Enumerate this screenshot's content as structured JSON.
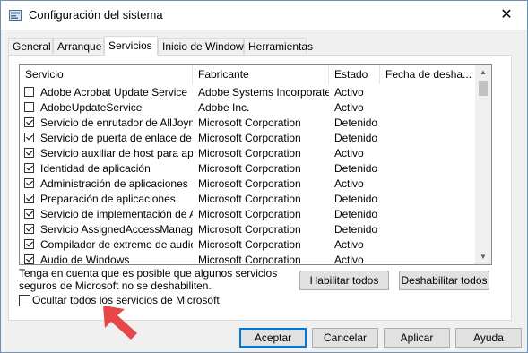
{
  "window": {
    "title": "Configuración del sistema",
    "close_glyph": "✕"
  },
  "tabs": [
    {
      "label": "General",
      "active": false
    },
    {
      "label": "Arranque",
      "active": false
    },
    {
      "label": "Servicios",
      "active": true
    },
    {
      "label": "Inicio de Windows",
      "active": false
    },
    {
      "label": "Herramientas",
      "active": false
    }
  ],
  "services_list": {
    "columns": [
      "Servicio",
      "Fabricante",
      "Estado",
      "Fecha de desha..."
    ],
    "rows": [
      {
        "checked": false,
        "service": "Adobe Acrobat Update Service",
        "manufacturer": "Adobe Systems Incorporated",
        "status": "Activo"
      },
      {
        "checked": false,
        "service": "AdobeUpdateService",
        "manufacturer": "Adobe Inc.",
        "status": "Activo"
      },
      {
        "checked": true,
        "service": "Servicio de enrutador de AllJoyn",
        "manufacturer": "Microsoft Corporation",
        "status": "Detenido"
      },
      {
        "checked": true,
        "service": "Servicio de puerta de enlace de ...",
        "manufacturer": "Microsoft Corporation",
        "status": "Detenido"
      },
      {
        "checked": true,
        "service": "Servicio auxiliar de host para apl...",
        "manufacturer": "Microsoft Corporation",
        "status": "Activo"
      },
      {
        "checked": true,
        "service": "Identidad de aplicación",
        "manufacturer": "Microsoft Corporation",
        "status": "Detenido"
      },
      {
        "checked": true,
        "service": "Administración de aplicaciones",
        "manufacturer": "Microsoft Corporation",
        "status": "Activo"
      },
      {
        "checked": true,
        "service": "Preparación de aplicaciones",
        "manufacturer": "Microsoft Corporation",
        "status": "Detenido"
      },
      {
        "checked": true,
        "service": "Servicio de implementación de A...",
        "manufacturer": "Microsoft Corporation",
        "status": "Detenido"
      },
      {
        "checked": true,
        "service": "Servicio AssignedAccessManager",
        "manufacturer": "Microsoft Corporation",
        "status": "Detenido"
      },
      {
        "checked": true,
        "service": "Compilador de extremo de audio...",
        "manufacturer": "Microsoft Corporation",
        "status": "Activo"
      },
      {
        "checked": true,
        "service": "Audio de Windows",
        "manufacturer": "Microsoft Corporation",
        "status": "Activo"
      }
    ]
  },
  "note": "Tenga en cuenta que es posible que algunos servicios seguros de Microsoft no se deshabiliten.",
  "buttons": {
    "enable_all": "Habilitar todos",
    "disable_all": "Deshabilitar todos",
    "ok": "Aceptar",
    "cancel": "Cancelar",
    "apply": "Aplicar",
    "help": "Ayuda"
  },
  "hide_ms_checkbox": {
    "label": "Ocultar todos los servicios de Microsoft",
    "checked": false
  },
  "colors": {
    "accent": "#0078d7",
    "arrow": "#e8474a"
  },
  "icons": {
    "app": "msconfig-icon",
    "annotation": "arrow-icon"
  }
}
